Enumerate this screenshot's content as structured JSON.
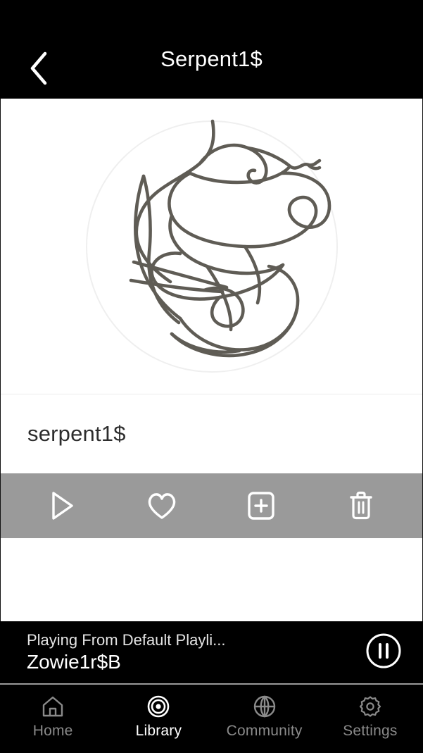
{
  "header": {
    "title": "Serpent1$",
    "back_icon": "chevron-left-icon"
  },
  "artwork": {
    "alt_name": "serpent-line-art",
    "stroke_color": "#5f5c55",
    "circle_color": "#efefef",
    "background": "#ffffff"
  },
  "detail": {
    "track_name": "serpent1$"
  },
  "actions": {
    "bar_color": "#9a9a9a",
    "items": [
      {
        "name": "play-button",
        "icon": "play-icon",
        "label": "Play"
      },
      {
        "name": "favorite-button",
        "icon": "heart-icon",
        "label": "Favorite"
      },
      {
        "name": "add-to-playlist-button",
        "icon": "plus-box-icon",
        "label": "Add to playlist"
      },
      {
        "name": "delete-button",
        "icon": "trash-icon",
        "label": "Delete"
      }
    ]
  },
  "now_playing": {
    "source": "Playing From Default Playli...",
    "title": "Zowie1r$B",
    "control_icon": "pause-circle-icon"
  },
  "bottom_nav": {
    "items": [
      {
        "label": "Home",
        "icon": "home-icon",
        "active": false
      },
      {
        "label": "Library",
        "icon": "target-icon",
        "active": true
      },
      {
        "label": "Community",
        "icon": "globe-icon",
        "active": false
      },
      {
        "label": "Settings",
        "icon": "gear-icon",
        "active": false
      }
    ]
  }
}
